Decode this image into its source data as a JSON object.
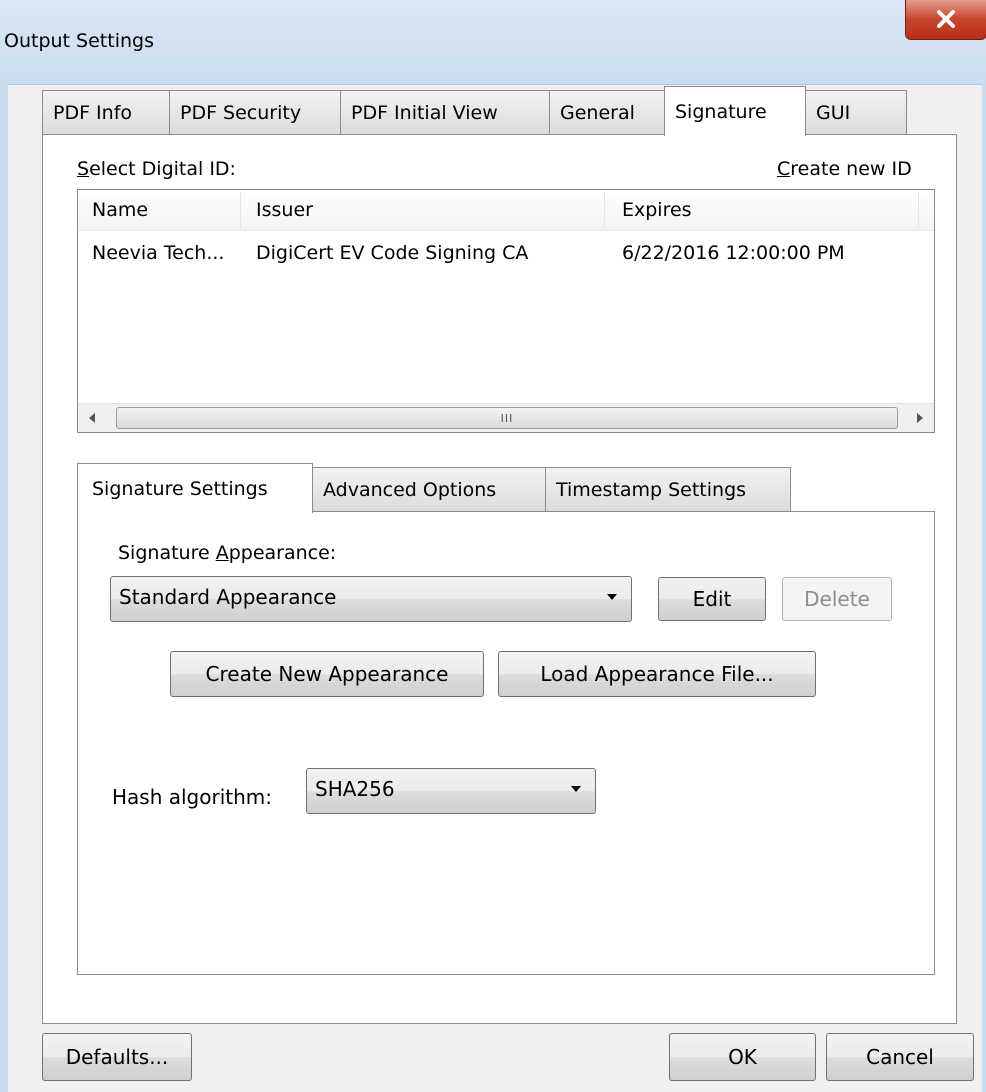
{
  "window": {
    "title": "Output Settings",
    "close_glyph": "X"
  },
  "tabs": [
    {
      "label": "PDF Info"
    },
    {
      "label": "PDF Security"
    },
    {
      "label": "PDF Initial View"
    },
    {
      "label": "General"
    },
    {
      "label": "Signature",
      "active": true
    },
    {
      "label": "GUI"
    }
  ],
  "signature": {
    "select_id_label_accel": "S",
    "select_id_label_rest": "elect Digital ID:",
    "create_id_accel": "C",
    "create_id_rest": "reate new ID",
    "columns": [
      "Name",
      "Issuer",
      "Expires"
    ],
    "rows": [
      {
        "name": "Neevia Tech...",
        "issuer": "DigiCert EV Code Signing CA",
        "expires": "6/22/2016 12:00:00 PM"
      }
    ],
    "scroll_grip": "III"
  },
  "sub_tabs": [
    {
      "label": "Signature Settings",
      "active": true
    },
    {
      "label": "Advanced Options"
    },
    {
      "label": "Timestamp Settings"
    }
  ],
  "settings": {
    "appearance_label_pre": "Signature ",
    "appearance_label_accel": "A",
    "appearance_label_post": "ppearance:",
    "appearance_value": "Standard Appearance",
    "edit_label": "Edit",
    "delete_label": "Delete",
    "create_appearance_label": "Create New Appearance",
    "load_appearance_label": "Load Appearance File...",
    "hash_label": "Hash algorithm:",
    "hash_value": "SHA256"
  },
  "footer": {
    "defaults_label": "Defaults...",
    "ok_label": "OK",
    "cancel_label": "Cancel"
  },
  "colors": {
    "close_button": "#c8452d",
    "panel_border": "#898c95",
    "dialog_bg": "#f0f0f0"
  }
}
